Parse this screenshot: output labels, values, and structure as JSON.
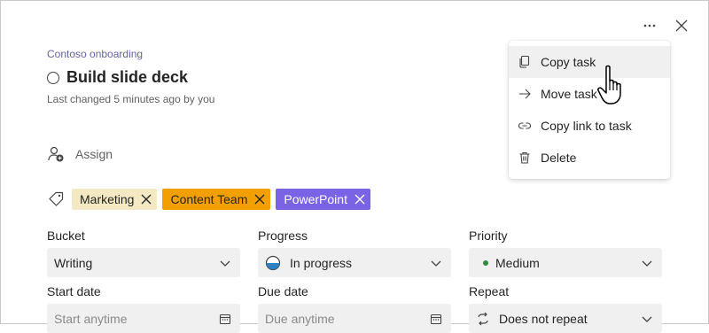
{
  "header": {
    "plan_name": "Contoso onboarding",
    "task_title": "Build slide deck",
    "last_changed": "Last changed 5 minutes ago by you"
  },
  "assign": {
    "label": "Assign"
  },
  "labels": [
    {
      "text": "Marketing",
      "color": "#f4e9c2"
    },
    {
      "text": "Content Team",
      "color": "#f2a000"
    },
    {
      "text": "PowerPoint",
      "color": "#7b63e6"
    }
  ],
  "fields": {
    "bucket": {
      "label": "Bucket",
      "value": "Writing"
    },
    "progress": {
      "label": "Progress",
      "value": "In progress"
    },
    "priority": {
      "label": "Priority",
      "value": "Medium"
    },
    "start_date": {
      "label": "Start date",
      "placeholder": "Start anytime"
    },
    "due_date": {
      "label": "Due date",
      "placeholder": "Due anytime"
    },
    "repeat": {
      "label": "Repeat",
      "value": "Does not repeat"
    }
  },
  "menu": {
    "items": [
      {
        "label": "Copy task",
        "icon": "copy-icon"
      },
      {
        "label": "Move task",
        "icon": "arrow-right-icon"
      },
      {
        "label": "Copy link to task",
        "icon": "link-icon"
      },
      {
        "label": "Delete",
        "icon": "trash-icon"
      }
    ]
  },
  "colors": {
    "accent": "#6264a7",
    "priority_medium": "#2e8b3d",
    "progress_in_progress": "#2f7fc1"
  }
}
